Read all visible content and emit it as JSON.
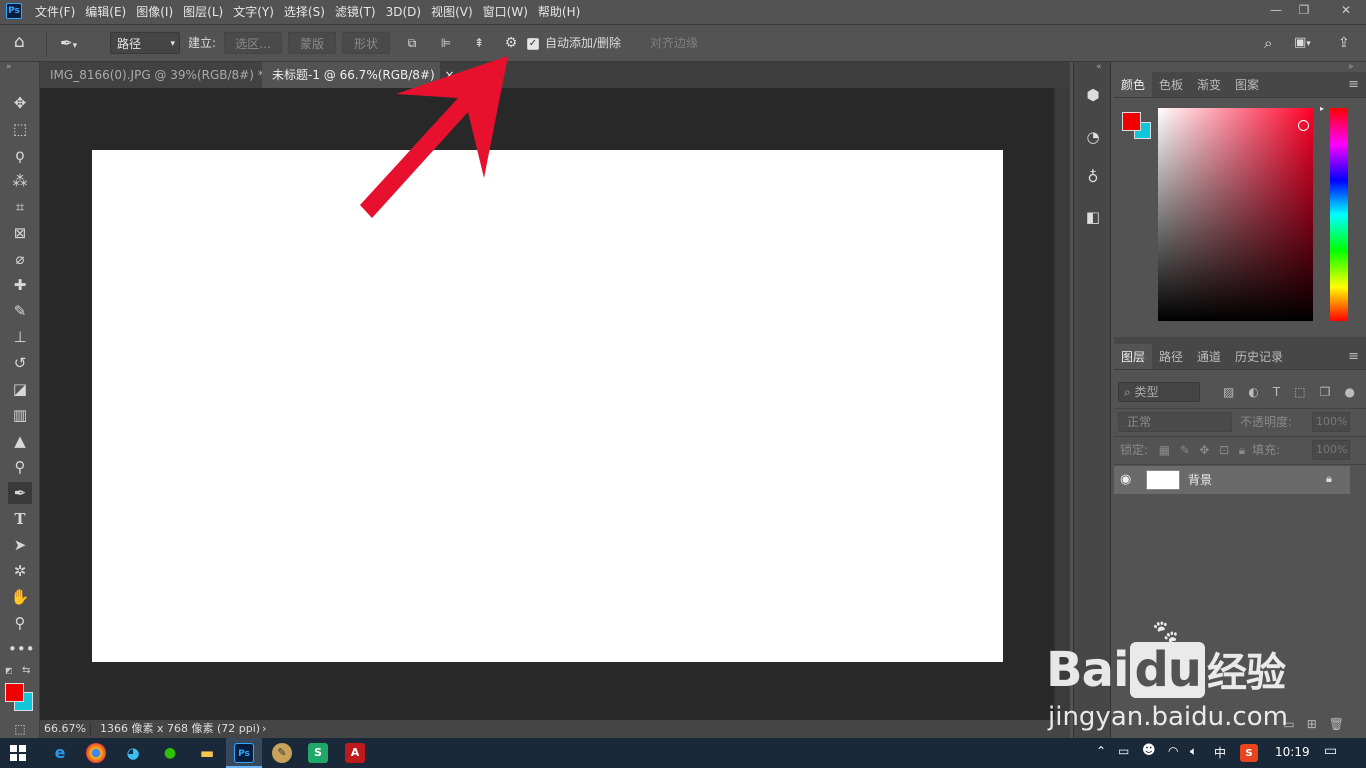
{
  "menubar": {
    "logo": "Ps",
    "items": [
      "文件(F)",
      "编辑(E)",
      "图像(I)",
      "图层(L)",
      "文字(Y)",
      "选择(S)",
      "滤镜(T)",
      "3D(D)",
      "视图(V)",
      "窗口(W)",
      "帮助(H)"
    ]
  },
  "options": {
    "mode_select": "路径",
    "make_label": "建立:",
    "selection_btn": "选区...",
    "mask_btn": "蒙版",
    "shape_btn": "形状",
    "auto_add_delete": "自动添加/删除",
    "align_edges": "对齐边缘"
  },
  "tabs": [
    {
      "label": "IMG_8166(0).JPG @ 39%(RGB/8#) *",
      "close": "×"
    },
    {
      "label": "未标题-1 @ 66.7%(RGB/8#)",
      "close": "×"
    }
  ],
  "status": {
    "zoom": "66.67%",
    "doc_info": "1366 像素 x 768 像素 (72 ppi)",
    "arrow": "›"
  },
  "color_panel": {
    "tabs": [
      "颜色",
      "色板",
      "渐变",
      "图案"
    ],
    "foreground": "#f00000",
    "background": "#11c6d8"
  },
  "layers_panel": {
    "tabs": [
      "图层",
      "路径",
      "通道",
      "历史记录"
    ],
    "filter_label": "类型",
    "blend_mode": "正常",
    "opacity_label": "不透明度:",
    "opacity_value": "100%",
    "lock_label": "锁定:",
    "fill_label": "填充:",
    "fill_value": "100%",
    "layers": [
      {
        "name": "背景"
      }
    ]
  },
  "taskbar": {
    "time": "10:19",
    "ime": "中"
  },
  "watermark": {
    "brand_a": "Bai",
    "brand_b": "du",
    "brand_c": "经验",
    "url": "jingyan.baidu.com"
  },
  "colors": {
    "arrow": "#e8112d",
    "ps_blue": "#31a8ff"
  }
}
